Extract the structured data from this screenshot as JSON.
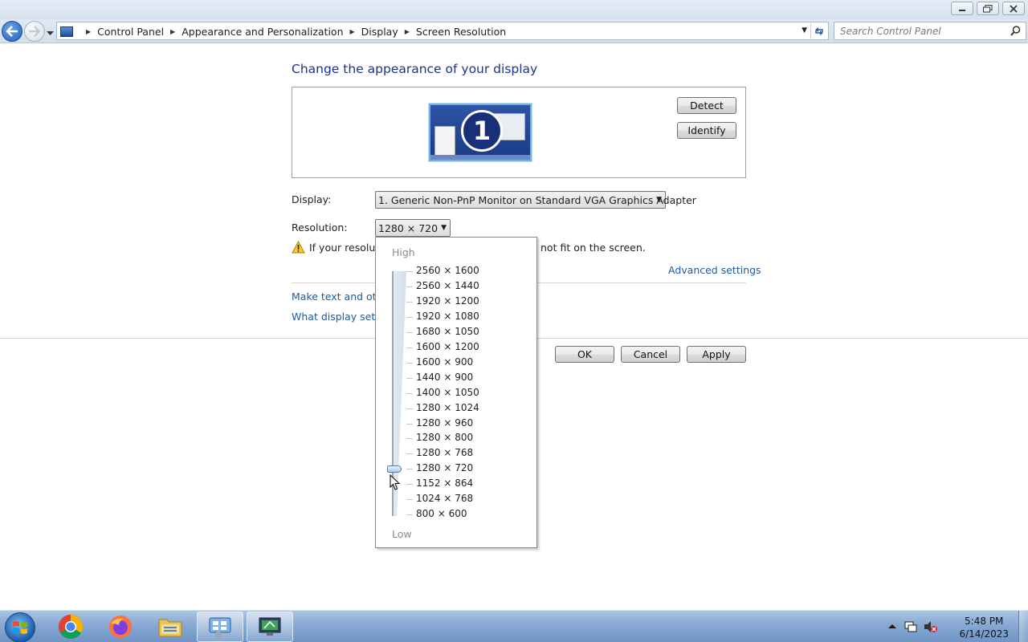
{
  "window": {
    "controls": [
      "minimize",
      "restore",
      "close"
    ]
  },
  "navigation": {
    "breadcrumbs": [
      "Control Panel",
      "Appearance and Personalization",
      "Display",
      "Screen Resolution"
    ],
    "search_placeholder": "Search Control Panel"
  },
  "main": {
    "title": "Change the appearance of your display",
    "monitor_number": "1",
    "detect_label": "Detect",
    "identify_label": "Identify",
    "display_label": "Display:",
    "display_value": "1. Generic Non-PnP Monitor on Standard VGA Graphics Adapter",
    "resolution_label": "Resolution:",
    "resolution_value": "1280 × 720",
    "warning_text_start": "If your resolutio",
    "warning_text_end": "not fit on the screen.",
    "advanced_settings": "Advanced settings",
    "link_text_size": "Make text and other",
    "link_what_settings": "What display setting",
    "ok_label": "OK",
    "cancel_label": "Cancel",
    "apply_label": "Apply"
  },
  "resolution_dropdown": {
    "high_label": "High",
    "low_label": "Low",
    "options": [
      "2560 × 1600",
      "2560 × 1440",
      "1920 × 1200",
      "1920 × 1080",
      "1680 × 1050",
      "1600 × 1200",
      "1600 × 900",
      "1440 × 900",
      "1400 × 1050",
      "1280 × 1024",
      "1280 × 960",
      "1280 × 800",
      "1280 × 768",
      "1280 × 720",
      "1152 × 864",
      "1024 × 768",
      "800 × 600"
    ],
    "selected_index": 13
  },
  "taskbar": {
    "items": [
      "chrome-icon",
      "firefox-icon",
      "file-explorer-icon",
      "control-panel-icon",
      "display-settings-icon"
    ],
    "time": "5:48 PM",
    "date": "6/14/2023"
  },
  "colors": {
    "title_blue": "#1e3287",
    "link_blue": "#1e5aa0",
    "taskbar": "#87a9d3"
  }
}
